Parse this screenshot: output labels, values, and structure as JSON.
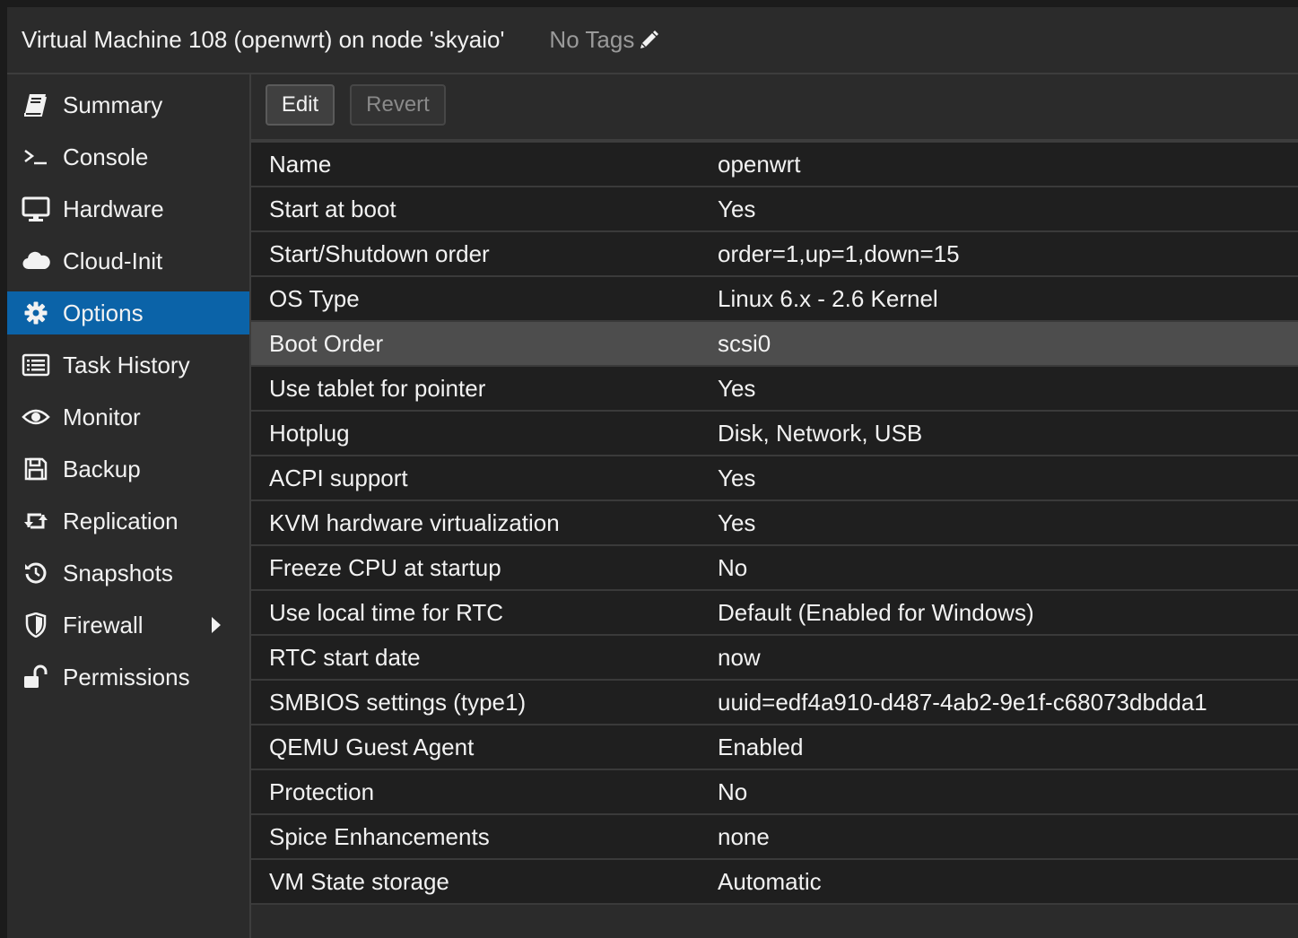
{
  "header": {
    "title": "Virtual Machine 108 (openwrt) on node 'skyaio'",
    "tags_label": "No Tags"
  },
  "sidebar": {
    "items": [
      {
        "label": "Summary",
        "icon": "book-icon",
        "active": false
      },
      {
        "label": "Console",
        "icon": "terminal-icon",
        "active": false
      },
      {
        "label": "Hardware",
        "icon": "desktop-icon",
        "active": false
      },
      {
        "label": "Cloud-Init",
        "icon": "cloud-icon",
        "active": false
      },
      {
        "label": "Options",
        "icon": "gear-icon",
        "active": true
      },
      {
        "label": "Task History",
        "icon": "list-icon",
        "active": false
      },
      {
        "label": "Monitor",
        "icon": "eye-icon",
        "active": false
      },
      {
        "label": "Backup",
        "icon": "floppy-icon",
        "active": false
      },
      {
        "label": "Replication",
        "icon": "retweet-icon",
        "active": false
      },
      {
        "label": "Snapshots",
        "icon": "history-icon",
        "active": false
      },
      {
        "label": "Firewall",
        "icon": "shield-icon",
        "active": false,
        "expandable": true
      },
      {
        "label": "Permissions",
        "icon": "unlock-icon",
        "active": false
      }
    ]
  },
  "toolbar": {
    "edit_label": "Edit",
    "revert_label": "Revert"
  },
  "options": [
    {
      "key": "Name",
      "value": "openwrt"
    },
    {
      "key": "Start at boot",
      "value": "Yes"
    },
    {
      "key": "Start/Shutdown order",
      "value": "order=1,up=1,down=15"
    },
    {
      "key": "OS Type",
      "value": "Linux 6.x - 2.6 Kernel"
    },
    {
      "key": "Boot Order",
      "value": "scsi0",
      "selected": true
    },
    {
      "key": "Use tablet for pointer",
      "value": "Yes"
    },
    {
      "key": "Hotplug",
      "value": "Disk, Network, USB"
    },
    {
      "key": "ACPI support",
      "value": "Yes"
    },
    {
      "key": "KVM hardware virtualization",
      "value": "Yes"
    },
    {
      "key": "Freeze CPU at startup",
      "value": "No"
    },
    {
      "key": "Use local time for RTC",
      "value": "Default (Enabled for Windows)"
    },
    {
      "key": "RTC start date",
      "value": "now"
    },
    {
      "key": "SMBIOS settings (type1)",
      "value": "uuid=edf4a910-d487-4ab2-9e1f-c68073dbdda1"
    },
    {
      "key": "QEMU Guest Agent",
      "value": "Enabled"
    },
    {
      "key": "Protection",
      "value": "No"
    },
    {
      "key": "Spice Enhancements",
      "value": "none"
    },
    {
      "key": "VM State storage",
      "value": "Automatic"
    }
  ],
  "colors": {
    "active_nav": "#0b63a8",
    "selected_row": "#4d4d4d",
    "background": "#2b2b2b"
  }
}
